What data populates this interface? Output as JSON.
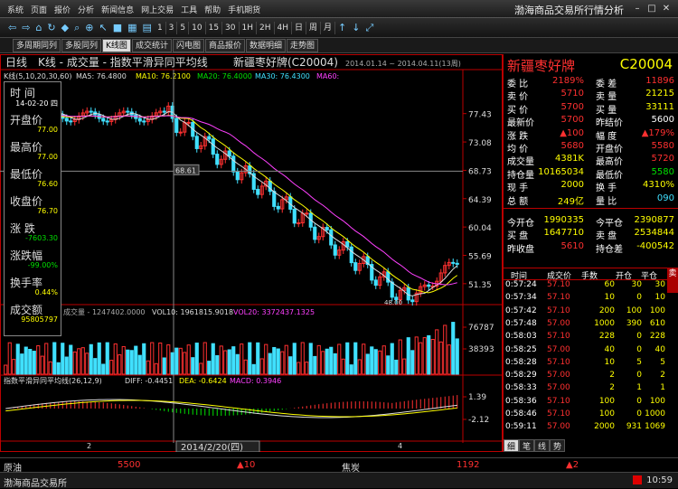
{
  "app": {
    "menu": [
      "系统",
      "页面",
      "报价",
      "分析",
      "新闻信息",
      "网上交易",
      "工具",
      "帮助",
      "手机期货"
    ],
    "title": "渤海商品交易所行情分析"
  },
  "toolbar": {
    "buttons": [
      "1",
      "3",
      "5",
      "10",
      "15",
      "30",
      "1H",
      "2H",
      "4H",
      "日",
      "周",
      "月"
    ]
  },
  "tabs": [
    "多周期同列",
    "多股同列",
    "K线图",
    "成交统计",
    "闪电图",
    "商品报价",
    "数据明细",
    "走势图"
  ],
  "chart": {
    "header": {
      "period": "日线",
      "kline": "K线 - 成交量 - 指数平滑异同平均线",
      "name": "新疆枣好牌(C20004)",
      "range": "2014.01.14 ~ 2014.04.11(13周)"
    },
    "ma_line": {
      "label": "K线(5,10,20,30,60)",
      "ma5": "MA5: 76.4800",
      "ma10": "MA10: 76.2100",
      "ma20": "MA20: 76.4000",
      "ma30": "MA30: 76.4300",
      "ma60": "MA60:"
    },
    "price_axis": [
      "77.43",
      "73.08",
      "68.73",
      "64.39",
      "60.04",
      "55.69",
      "51.35"
    ],
    "price_min": 48.0,
    "price_max": 80.0,
    "crosshair_value": "68.61",
    "low_label": "48.00",
    "vol_header": {
      "label": "成交量 - 1247402.0000",
      "vol10": "VOL10: 1961815.9018",
      "vol20": "VOL20: 3372437.1325"
    },
    "vol_axis": [
      "76787",
      "38393"
    ],
    "macd_header": {
      "label": "指数平滑异同平均线(26,12,9)",
      "diff": "DIFF: -0.4451",
      "dea": "DEA: -0.6424",
      "macd": "MACD: 0.3946"
    },
    "macd_axis": [
      "1.39",
      "-2.12"
    ],
    "date_box": "2014/2/20(四)",
    "bottom_ticks": [
      "2",
      "4"
    ],
    "info_box": {
      "time_label": "时 间",
      "time": "14-02-20 四",
      "open_label": "开盘价",
      "open": "77.00",
      "high_label": "最高价",
      "high": "77.00",
      "low_label": "最低价",
      "low": "76.60",
      "close_label": "收盘价",
      "close": "76.70",
      "change_label": "涨 跌",
      "change": "-7603.30",
      "pct_label": "涨跌幅",
      "pct": "-99.00%",
      "turnover_label": "换手率",
      "turnover": "0.44%",
      "amount_label": "成交额",
      "amount": "95805797"
    }
  },
  "quote": {
    "name": "新疆枣好牌",
    "code": "C20004",
    "rows": [
      {
        "l1": "委 比",
        "v1": "2189%",
        "l2": "委 差",
        "v2": "11896"
      },
      {
        "l1": "卖 价",
        "v1": "5710",
        "l2": "卖 量",
        "v2": "21215"
      },
      {
        "l1": "买 价",
        "v1": "5700",
        "l2": "买 量",
        "v2": "33111"
      },
      {
        "l1": "最新价",
        "v1": "5700",
        "l2": "昨结价",
        "v2": "5600"
      },
      {
        "l1": "涨 跌",
        "v1": "▲100",
        "l2": "幅 度",
        "v2": "▲179%"
      },
      {
        "l1": "均 价",
        "v1": "5680",
        "l2": "开盘价",
        "v2": "5580"
      },
      {
        "l1": "成交量",
        "v1": "4381K",
        "l2": "最高价",
        "v2": "5720"
      },
      {
        "l1": "持仓量",
        "v1": "10165034",
        "l2": "最低价",
        "v2": "5580"
      },
      {
        "l1": "现 手",
        "v1": "2000",
        "l2": "换 手",
        "v2": "4310%"
      },
      {
        "l1": "总 额",
        "v1": "249亿",
        "l2": "量 比",
        "v2": "090"
      }
    ],
    "rows2": [
      {
        "l1": "今开仓",
        "v1": "1990335",
        "l2": "今平仓",
        "v2": "2390877"
      },
      {
        "l1": "买 盘",
        "v1": "1647710",
        "l2": "卖 盘",
        "v2": "2534844"
      },
      {
        "l1": "昨收盘",
        "v1": "5610",
        "l2": "持仓差",
        "v2": "-400542"
      }
    ],
    "tick_header": [
      "时间",
      "成交价",
      "手数",
      "开仓",
      "平仓"
    ],
    "ticks": [
      [
        "0:57:24",
        "57.10",
        "60",
        "30",
        "30"
      ],
      [
        "0:57:34",
        "57.10",
        "10",
        "0",
        "10"
      ],
      [
        "0:57:42",
        "57.10",
        "200",
        "100",
        "100"
      ],
      [
        "0:57:48",
        "57.00",
        "1000",
        "390",
        "610"
      ],
      [
        "0:58:03",
        "57.10",
        "228",
        "0",
        "228"
      ],
      [
        "0:58:25",
        "57.00",
        "40",
        "0",
        "40"
      ],
      [
        "0:58:28",
        "57.10",
        "10",
        "5",
        "5"
      ],
      [
        "0:58:29",
        "57.00",
        "2",
        "0",
        "2"
      ],
      [
        "0:58:33",
        "57.00",
        "2",
        "1",
        "1"
      ],
      [
        "0:58:36",
        "57.10",
        "100",
        "0",
        "100"
      ],
      [
        "0:58:46",
        "57.10",
        "100",
        "0",
        "1000"
      ],
      [
        "0:59:11",
        "57.00",
        "2000",
        "931",
        "1069"
      ]
    ],
    "side_tab": "卖",
    "bottom_tabs": [
      "细",
      "笔",
      "线",
      "势"
    ]
  },
  "bottom": {
    "left_name": "原油",
    "left_price": "5500",
    "left_change": "▲10",
    "right_name": "焦炭",
    "right_price": "1192",
    "right_change": "▲2"
  },
  "status": {
    "left": "渤海商品交易所",
    "time": "10:59"
  }
}
